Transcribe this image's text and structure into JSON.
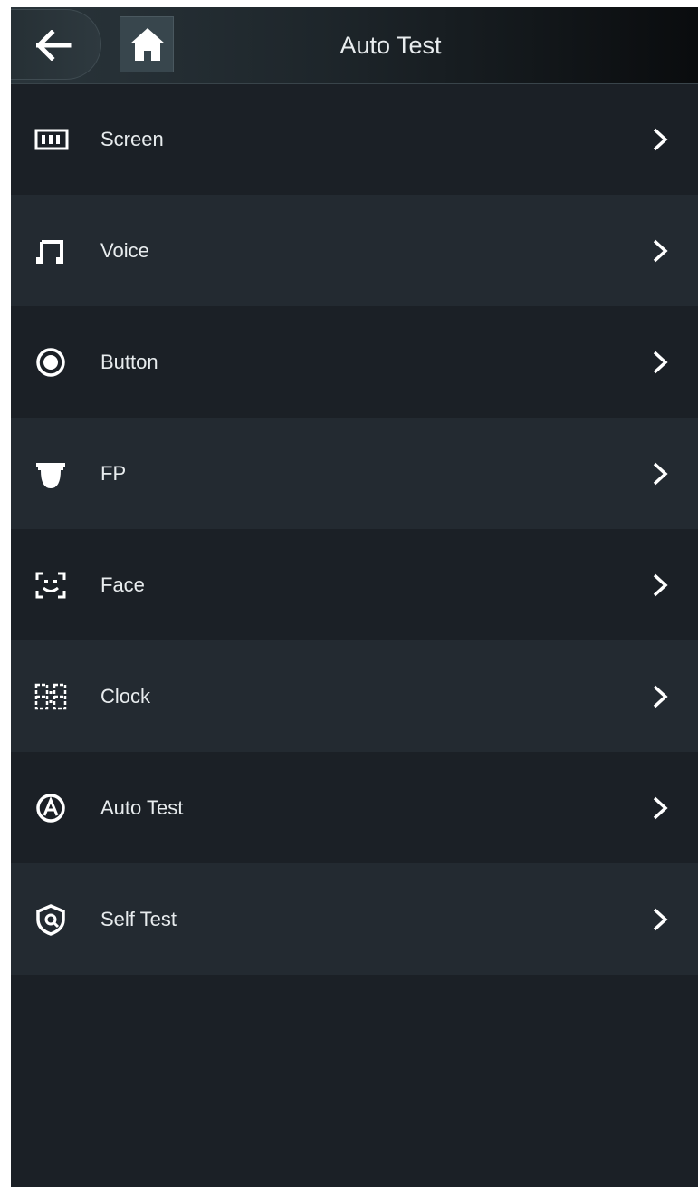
{
  "header": {
    "title": "Auto Test",
    "back_icon": "arrow-left-icon",
    "home_icon": "home-icon"
  },
  "menu": {
    "items": [
      {
        "label": "Screen",
        "icon": "screen-icon"
      },
      {
        "label": "Voice",
        "icon": "music-note-icon"
      },
      {
        "label": "Button",
        "icon": "button-icon"
      },
      {
        "label": "FP",
        "icon": "fingerprint-sensor-icon"
      },
      {
        "label": "Face",
        "icon": "face-scan-icon"
      },
      {
        "label": "Clock",
        "icon": "clock-digits-icon"
      },
      {
        "label": "Auto Test",
        "icon": "auto-test-icon"
      },
      {
        "label": "Self Test",
        "icon": "self-test-shield-icon"
      }
    ],
    "chevron_icon": "chevron-right-icon"
  },
  "colors": {
    "background": "#1b2026",
    "alt_row": "#232a31",
    "text": "#e8ecee"
  }
}
